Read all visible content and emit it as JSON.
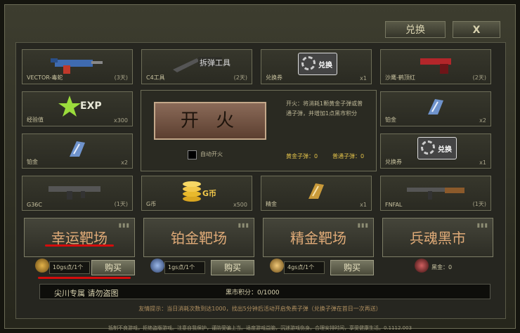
{
  "header": {
    "exchange_label": "兑换",
    "close_label": "X"
  },
  "grid": [
    {
      "name": "VECTOR-毒蛇",
      "qty": "(3天)"
    },
    {
      "name": "C4工具",
      "qty": "(2天)",
      "overlay": "拆弹工具"
    },
    {
      "name": "兑换券",
      "qty": "x1",
      "overlay": "兑换"
    },
    {
      "name": "沙鹰-鹤顶红",
      "qty": "(2天)"
    },
    {
      "name": "经验值",
      "qty": "x300",
      "overlay": "EXP"
    },
    {
      "name": "铂金",
      "qty": "x2"
    },
    {
      "name": "铂金",
      "qty": "x2"
    },
    {
      "name": "兑换券",
      "qty": "x1",
      "overlay": "兑换"
    },
    {
      "name": "G36C",
      "qty": "(1天)"
    },
    {
      "name": "G币",
      "qty": "x500",
      "overlay": "G币"
    },
    {
      "name": "精金",
      "qty": "x1"
    },
    {
      "name": "FNFAL",
      "qty": "(1天)"
    }
  ],
  "center": {
    "fire_label": "开 火",
    "auto_fire_label": "自动开火",
    "description": "开火：将消耗1颗黄金子弹或普通子弹，并增加1点黑市积分",
    "gold_ammo": "黄金子弹：0",
    "normal_ammo": "普通子弹：0"
  },
  "ranges": [
    {
      "title": "幸运靶场",
      "price": "10gs点/1个",
      "buy": "购买"
    },
    {
      "title": "铂金靶场",
      "price": "1gs点/1个",
      "buy": "购买"
    },
    {
      "title": "精金靶场",
      "price": "4gs点/1个",
      "buy": "购买"
    },
    {
      "title": "兵魂黑市",
      "blackmarket": "黑金：0"
    }
  ],
  "bottom": {
    "exclusive": "尖川专属 请勿盗图",
    "points": "黑市积分：0/1000"
  },
  "footnote": "友情提示：当日消耗次数到达1000，找出5分钟后活动开启免费子弹（兑换子弹在首日一次再送）",
  "disclaimer": "抵制不良游戏，拒绝盗版游戏。注意自我保护，谨防受骗上当。适度游戏益脑，沉迷游戏伤身。合理安排时间，享受健康生活。0.1112.003",
  "colors": {
    "gold": "#e3c24a",
    "range_title": "#e0ab78",
    "red_mark": "#d40c0c"
  }
}
